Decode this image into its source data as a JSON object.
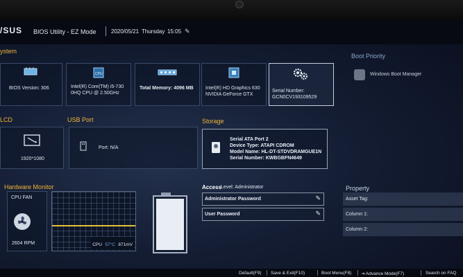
{
  "header": {
    "brand": "/SUS",
    "title": "BIOS Utility - EZ Mode",
    "date": "2020/05/21",
    "weekday": "Thursday",
    "time": "15:05"
  },
  "system": {
    "label": "ystem",
    "bios_version": "BIOS Version: 306",
    "cpu_line1": "Intel(R) Core(TM) i5-730",
    "cpu_line2": "0HQ CPU @ 2.50GHz",
    "memory": "Total Memory: 4096 MB",
    "gpu_line1": "Intel(R) HD Graphics 630",
    "gpu_line2": "NVIDIA GeForce GTX",
    "serial_label": "Serial Number:",
    "serial_value": "GCN0CV193109529"
  },
  "boot_priority": {
    "label": "Boot Priority",
    "item": "Windows Boot Manager"
  },
  "lcd": {
    "label": "LCD",
    "resolution": "1920*1080"
  },
  "usb": {
    "label": "USB Port",
    "port": "Port: N/A"
  },
  "storage": {
    "label": "Storage",
    "line1": "Serial ATA Port 2",
    "line2": "Device Type: ATAPI CDROM",
    "line3": "Model Name: HL-DT-STDVDRAMGUE1N",
    "line4": "Serial Number: KWBGBFN4649"
  },
  "hardware_monitor": {
    "label": "Hardware Monitor",
    "fan_label": "CPU FAN",
    "fan_rpm": "2604 RPM",
    "cpu_readout": "CPU",
    "cpu_temp": "57°C",
    "cpu_volt": "871mV"
  },
  "access": {
    "label": "Access",
    "level": "Level: Administrator",
    "admin_password": "Administrator Password",
    "user_password": "User Password"
  },
  "property": {
    "label": "Property",
    "asset_tag": "Asset Tag:",
    "column1": "Column 1:",
    "column2": "Column 2:"
  },
  "footer": {
    "default": "Default(F9)",
    "save_exit": "Save & Exit(F10)",
    "boot_menu": "Boot Menu(F8)",
    "advance_mode": "Advance Mode(F7)",
    "search_faq": "Search on FAQ"
  },
  "colors": {
    "section_orange": "#f0b43c",
    "graph_line": "#e6c13a",
    "background": "#141d33"
  }
}
